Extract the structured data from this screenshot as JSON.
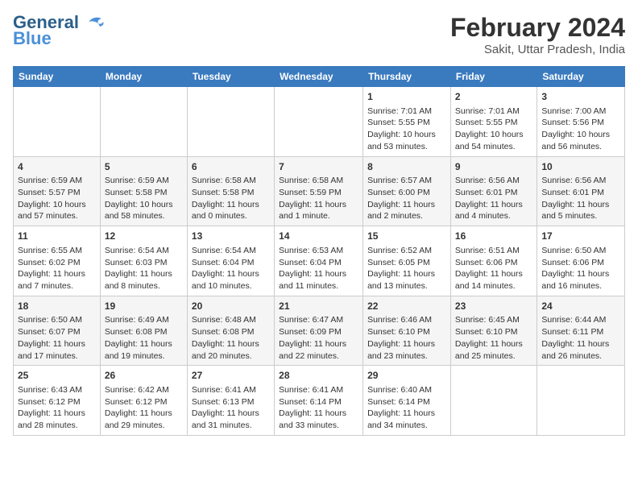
{
  "header": {
    "logo_general": "General",
    "logo_blue": "Blue",
    "month_title": "February 2024",
    "subtitle": "Sakit, Uttar Pradesh, India"
  },
  "weekdays": [
    "Sunday",
    "Monday",
    "Tuesday",
    "Wednesday",
    "Thursday",
    "Friday",
    "Saturday"
  ],
  "weeks": [
    [
      {
        "day": "",
        "content": ""
      },
      {
        "day": "",
        "content": ""
      },
      {
        "day": "",
        "content": ""
      },
      {
        "day": "",
        "content": ""
      },
      {
        "day": "1",
        "content": "Sunrise: 7:01 AM\nSunset: 5:55 PM\nDaylight: 10 hours\nand 53 minutes."
      },
      {
        "day": "2",
        "content": "Sunrise: 7:01 AM\nSunset: 5:55 PM\nDaylight: 10 hours\nand 54 minutes."
      },
      {
        "day": "3",
        "content": "Sunrise: 7:00 AM\nSunset: 5:56 PM\nDaylight: 10 hours\nand 56 minutes."
      }
    ],
    [
      {
        "day": "4",
        "content": "Sunrise: 6:59 AM\nSunset: 5:57 PM\nDaylight: 10 hours\nand 57 minutes."
      },
      {
        "day": "5",
        "content": "Sunrise: 6:59 AM\nSunset: 5:58 PM\nDaylight: 10 hours\nand 58 minutes."
      },
      {
        "day": "6",
        "content": "Sunrise: 6:58 AM\nSunset: 5:58 PM\nDaylight: 11 hours\nand 0 minutes."
      },
      {
        "day": "7",
        "content": "Sunrise: 6:58 AM\nSunset: 5:59 PM\nDaylight: 11 hours\nand 1 minute."
      },
      {
        "day": "8",
        "content": "Sunrise: 6:57 AM\nSunset: 6:00 PM\nDaylight: 11 hours\nand 2 minutes."
      },
      {
        "day": "9",
        "content": "Sunrise: 6:56 AM\nSunset: 6:01 PM\nDaylight: 11 hours\nand 4 minutes."
      },
      {
        "day": "10",
        "content": "Sunrise: 6:56 AM\nSunset: 6:01 PM\nDaylight: 11 hours\nand 5 minutes."
      }
    ],
    [
      {
        "day": "11",
        "content": "Sunrise: 6:55 AM\nSunset: 6:02 PM\nDaylight: 11 hours\nand 7 minutes."
      },
      {
        "day": "12",
        "content": "Sunrise: 6:54 AM\nSunset: 6:03 PM\nDaylight: 11 hours\nand 8 minutes."
      },
      {
        "day": "13",
        "content": "Sunrise: 6:54 AM\nSunset: 6:04 PM\nDaylight: 11 hours\nand 10 minutes."
      },
      {
        "day": "14",
        "content": "Sunrise: 6:53 AM\nSunset: 6:04 PM\nDaylight: 11 hours\nand 11 minutes."
      },
      {
        "day": "15",
        "content": "Sunrise: 6:52 AM\nSunset: 6:05 PM\nDaylight: 11 hours\nand 13 minutes."
      },
      {
        "day": "16",
        "content": "Sunrise: 6:51 AM\nSunset: 6:06 PM\nDaylight: 11 hours\nand 14 minutes."
      },
      {
        "day": "17",
        "content": "Sunrise: 6:50 AM\nSunset: 6:06 PM\nDaylight: 11 hours\nand 16 minutes."
      }
    ],
    [
      {
        "day": "18",
        "content": "Sunrise: 6:50 AM\nSunset: 6:07 PM\nDaylight: 11 hours\nand 17 minutes."
      },
      {
        "day": "19",
        "content": "Sunrise: 6:49 AM\nSunset: 6:08 PM\nDaylight: 11 hours\nand 19 minutes."
      },
      {
        "day": "20",
        "content": "Sunrise: 6:48 AM\nSunset: 6:08 PM\nDaylight: 11 hours\nand 20 minutes."
      },
      {
        "day": "21",
        "content": "Sunrise: 6:47 AM\nSunset: 6:09 PM\nDaylight: 11 hours\nand 22 minutes."
      },
      {
        "day": "22",
        "content": "Sunrise: 6:46 AM\nSunset: 6:10 PM\nDaylight: 11 hours\nand 23 minutes."
      },
      {
        "day": "23",
        "content": "Sunrise: 6:45 AM\nSunset: 6:10 PM\nDaylight: 11 hours\nand 25 minutes."
      },
      {
        "day": "24",
        "content": "Sunrise: 6:44 AM\nSunset: 6:11 PM\nDaylight: 11 hours\nand 26 minutes."
      }
    ],
    [
      {
        "day": "25",
        "content": "Sunrise: 6:43 AM\nSunset: 6:12 PM\nDaylight: 11 hours\nand 28 minutes."
      },
      {
        "day": "26",
        "content": "Sunrise: 6:42 AM\nSunset: 6:12 PM\nDaylight: 11 hours\nand 29 minutes."
      },
      {
        "day": "27",
        "content": "Sunrise: 6:41 AM\nSunset: 6:13 PM\nDaylight: 11 hours\nand 31 minutes."
      },
      {
        "day": "28",
        "content": "Sunrise: 6:41 AM\nSunset: 6:14 PM\nDaylight: 11 hours\nand 33 minutes."
      },
      {
        "day": "29",
        "content": "Sunrise: 6:40 AM\nSunset: 6:14 PM\nDaylight: 11 hours\nand 34 minutes."
      },
      {
        "day": "",
        "content": ""
      },
      {
        "day": "",
        "content": ""
      }
    ]
  ]
}
